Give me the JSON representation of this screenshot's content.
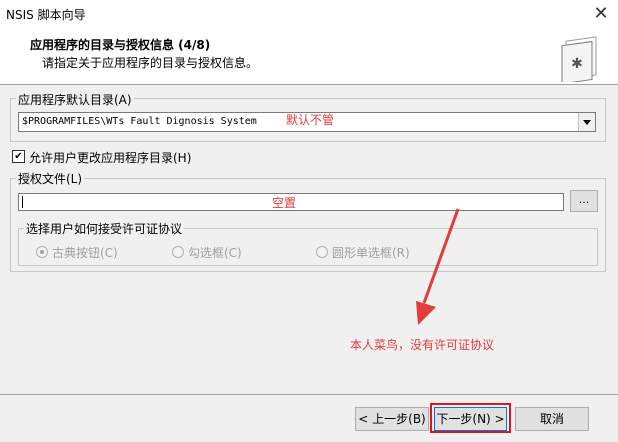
{
  "window": {
    "title": "NSIS 脚本向导"
  },
  "header": {
    "title": "应用程序的目录与授权信息 (4/8)",
    "subtitle": "请指定关于应用程序的目录与授权信息。"
  },
  "default_dir": {
    "legend": "应用程序默认目录(A)",
    "value": "$PROGRAMFILES\\WTs Fault Dignosis System",
    "annotation": "默认不管"
  },
  "allow_change": {
    "label": "允许用户更改应用程序目录(H)",
    "checked": true
  },
  "license": {
    "legend": "授权文件(L)",
    "value": "",
    "annotation": "空置",
    "browse_label": "...",
    "accept_group": {
      "legend": "选择用户如何接受许可证协议",
      "options": [
        "古典按钮(C)",
        "勾选框(C)",
        "圆形单选框(R)"
      ],
      "selected": "古典按钮(C)"
    }
  },
  "annotation_note": "本人菜鸟，没有许可证协议",
  "buttons": {
    "back": "< 上一步(B)",
    "next": "下一步(N) >",
    "cancel": "取消"
  },
  "colors": {
    "annotation_red": "#e53b3b",
    "highlight_red": "#e0141e"
  }
}
